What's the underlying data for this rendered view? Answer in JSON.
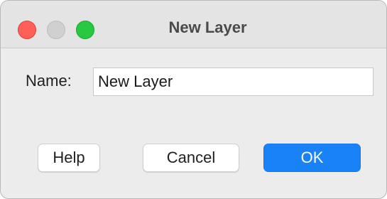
{
  "dialog": {
    "title": "New Layer",
    "name_label": "Name:",
    "name_value": "New Layer"
  },
  "buttons": {
    "help": "Help",
    "cancel": "Cancel",
    "ok": "OK"
  },
  "colors": {
    "accent": "#1a82f7",
    "close_light": "#fe5f57",
    "zoom_light": "#28c840"
  }
}
